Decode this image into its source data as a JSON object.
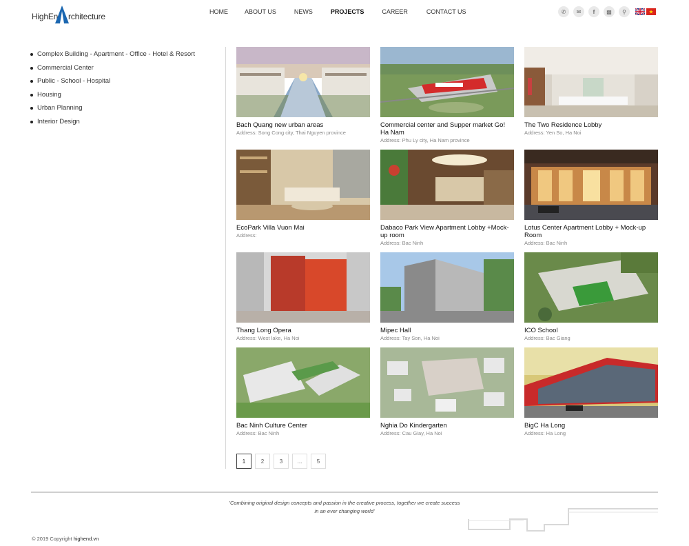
{
  "logo": {
    "part1": "HighEnd",
    "part2": "rchitecture"
  },
  "nav": [
    {
      "label": "HOME",
      "active": false
    },
    {
      "label": "ABOUT US",
      "active": false
    },
    {
      "label": "NEWS",
      "active": false
    },
    {
      "label": "PROJECTS",
      "active": true
    },
    {
      "label": "CAREER",
      "active": false
    },
    {
      "label": "CONTACT US",
      "active": false
    }
  ],
  "header_icons": [
    "phone-icon",
    "mail-icon",
    "facebook-icon",
    "chat-icon",
    "search-icon"
  ],
  "languages": [
    "English",
    "Tiếng Việt"
  ],
  "sidebar": [
    "Complex Building - Apartment - Office - Hotel & Resort",
    "Commercial Center",
    "Public - School - Hospital",
    "Housing",
    "Urban Planning",
    "Interior Design"
  ],
  "projects": [
    {
      "title": "Bach Quang new urban areas",
      "address": "Address: Song Cong city, Thai Nguyen province"
    },
    {
      "title": "Commercial center and Supper market Go! Ha Nam",
      "address": "Address: Phu Ly city, Ha Nam province"
    },
    {
      "title": "The Two Residence Lobby",
      "address": "Address: Yen So, Ha Noi"
    },
    {
      "title": "EcoPark Villa Vuon Mai",
      "address": "Address:"
    },
    {
      "title": "Dabaco Park View Apartment Lobby +Mock-up room",
      "address": "Address: Bac Ninh"
    },
    {
      "title": "Lotus Center Apartment Lobby + Mock-up Room",
      "address": "Address: Bac Ninh"
    },
    {
      "title": "Thang Long Opera",
      "address": "Address: West lake, Ha Noi"
    },
    {
      "title": "Mipec Hall",
      "address": "Address: Tay Son, Ha Noi"
    },
    {
      "title": "ICO School",
      "address": "Address: Bac Giang"
    },
    {
      "title": "Bac Ninh Culture Center",
      "address": "Address: Bac Ninh"
    },
    {
      "title": "Nghia Do Kindergarten",
      "address": "Address: Cau Giay, Ha Noi"
    },
    {
      "title": "BigC Ha Long",
      "address": "Address: Ha Long"
    }
  ],
  "pagination": [
    "1",
    "2",
    "3",
    "...",
    "5"
  ],
  "current_page": "1",
  "footer": {
    "quote_line1": "'Combining original design concepts and passion in the creative process, together we create success",
    "quote_line2": "in an ever changing world'",
    "copyright_prefix": "© 2019 Copyright",
    "copyright_site": "highend.vn"
  },
  "colors": {
    "accent": "#1a66b0",
    "text": "#222222",
    "muted": "#888888"
  }
}
